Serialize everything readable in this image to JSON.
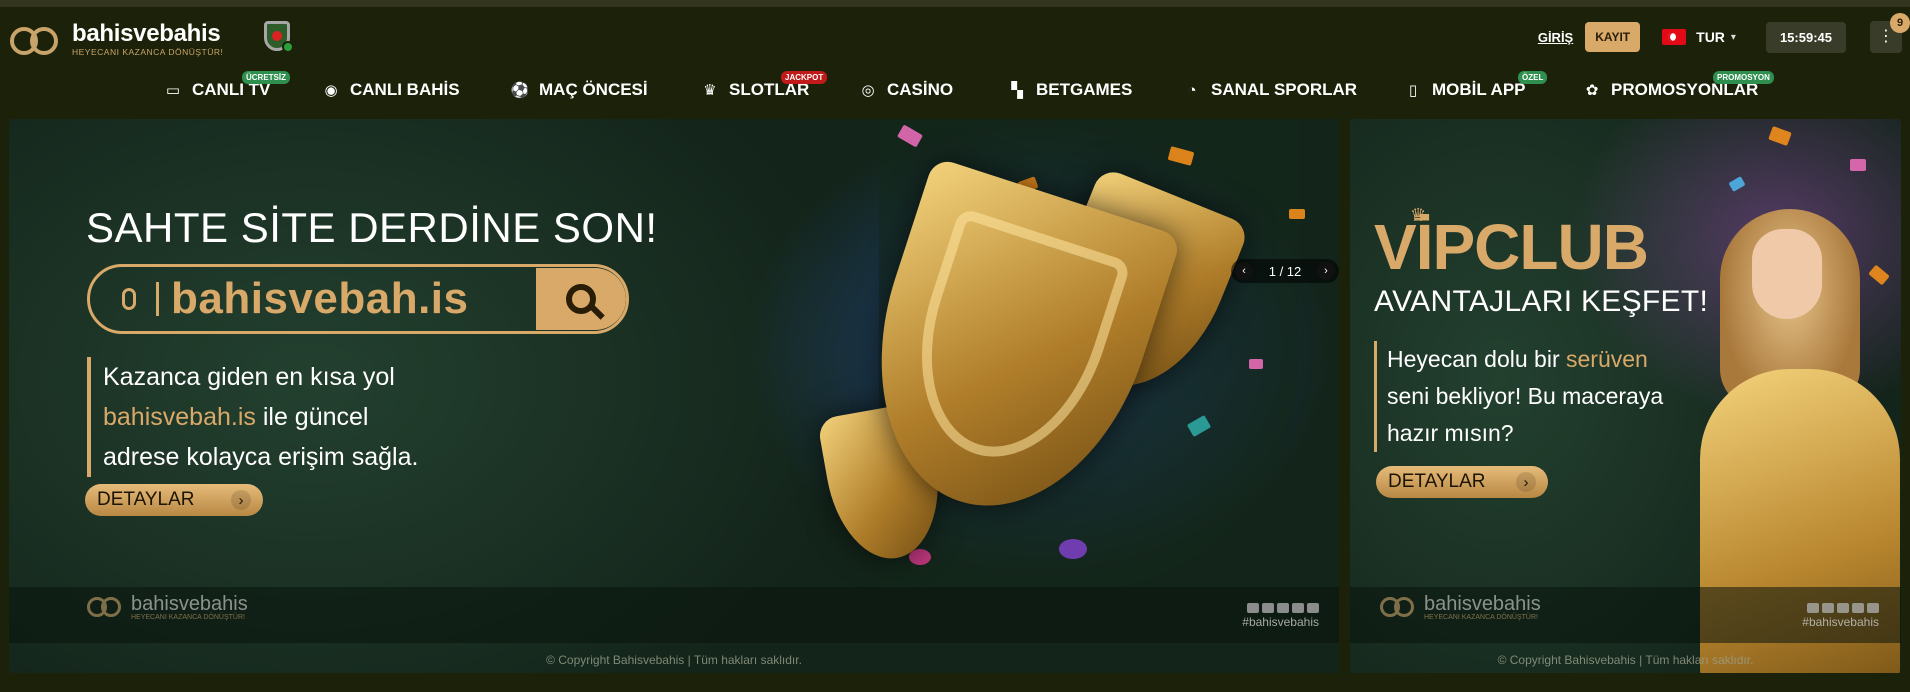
{
  "brand": {
    "name": "bahisvebahis",
    "tagline": "HEYECANI KAZANCA DÖNÜŞTÜR!"
  },
  "header": {
    "login_label": "GİRİŞ",
    "register_label": "KAYIT",
    "language": "TUR",
    "clock": "15:59:45",
    "menu_badge": "9"
  },
  "nav": {
    "items": [
      {
        "label": "CANLI TV",
        "icon": "tv-icon",
        "badge": "ÜCRETSİZ"
      },
      {
        "label": "CANLI BAHİS",
        "icon": "live-icon",
        "badge": ""
      },
      {
        "label": "MAÇ ÖNCESİ",
        "icon": "soccer-ball-icon",
        "badge": ""
      },
      {
        "label": "SLOTLAR",
        "icon": "slot-icon",
        "badge": "JACKPOT"
      },
      {
        "label": "CASİNO",
        "icon": "casino-chip-icon",
        "badge": ""
      },
      {
        "label": "BETGAMES",
        "icon": "betgames-icon",
        "badge": ""
      },
      {
        "label": "SANAL SPORLAR",
        "icon": "virtual-sports-icon",
        "badge": ""
      },
      {
        "label": "MOBİL APP",
        "icon": "mobile-icon",
        "badge": "ÖZEL"
      },
      {
        "label": "PROMOSYONLAR",
        "icon": "gift-icon",
        "badge": "PROMOSYON"
      }
    ]
  },
  "banner_main": {
    "title": "SAHTE SİTE DERDİNE SON!",
    "url": "bahisvebah.is",
    "desc_line1": "Kazanca giden en kısa yol",
    "desc_link": "bahisvebah.is",
    "desc_line2_rest": " ile güncel",
    "desc_line3": "adrese kolayca erişim sağla.",
    "cta": "DETAYLAR",
    "pager": "1 / 12",
    "hashtag": "#bahisvebahis",
    "copyright": "©    Copyright Bahisvebahis | Tüm hakları saklıdır."
  },
  "banner_side": {
    "title": "VİPCLUB",
    "subtitle": "AVANTAJLARI KEŞFET!",
    "desc_line1_a": "Heyecan dolu bir ",
    "desc_line1_b": "serüven",
    "desc_line2": "seni bekliyor! Bu maceraya",
    "desc_line3": "hazır mısın?",
    "cta": "DETAYLAR",
    "hashtag": "#bahisvebahis",
    "copyright": "©    Copyright Bahisvebahis | Tüm hakları saklıdır."
  },
  "colors": {
    "background": "#1c2209",
    "accent_gold": "#d9a969",
    "badge_green": "#2e8f4f",
    "badge_red": "#c01a1a"
  }
}
